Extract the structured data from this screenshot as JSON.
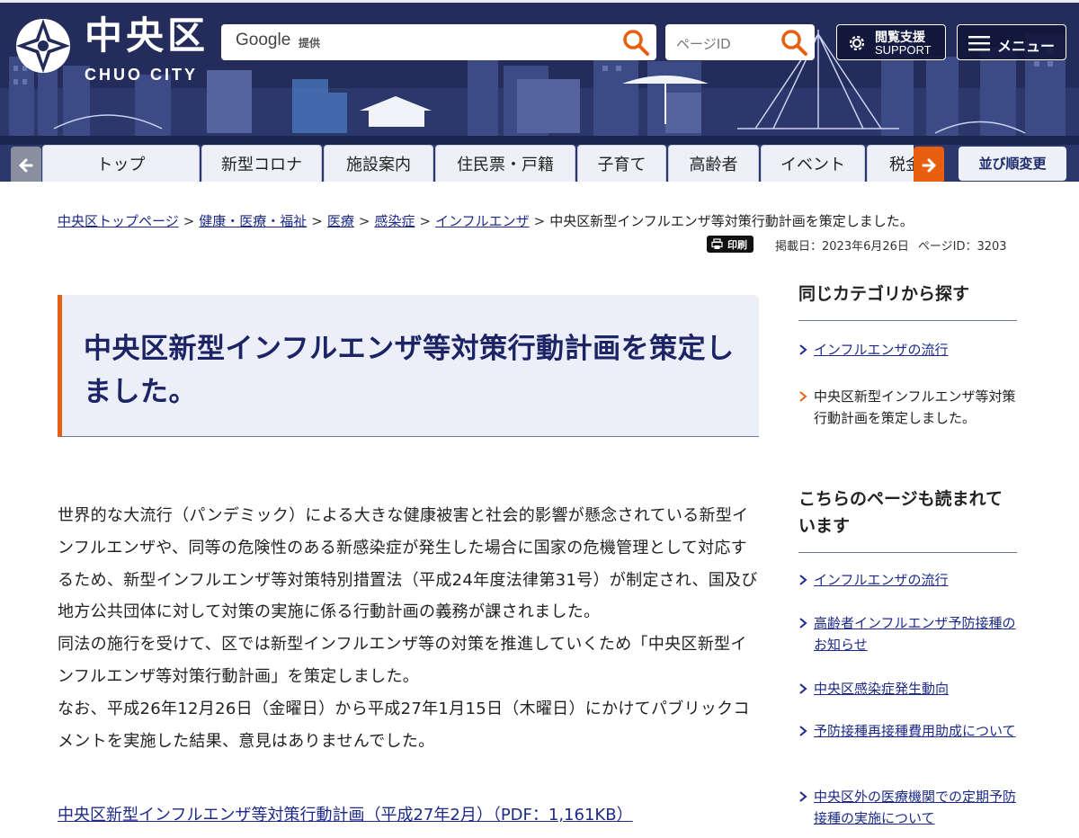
{
  "header": {
    "logo_kanji": "中央区",
    "logo_roman": "CHUO CITY",
    "google_label": "Google",
    "google_sub": "提供",
    "pageid_placeholder": "ページID",
    "support_line1": "閲覧支援",
    "support_line2": "SUPPORT",
    "menu_label": "メニュー",
    "colors": {
      "background": "#232c5a",
      "accent": "#e8600f",
      "title_text": "#1c2466"
    }
  },
  "nav": {
    "tabs": [
      "トップ",
      "新型コロナ",
      "施設案内",
      "住民票・戸籍",
      "子育て",
      "高齢者",
      "イベント",
      "税金"
    ],
    "sort_label": "並び順変更"
  },
  "breadcrumb": {
    "items": [
      "中央区トップページ",
      "健康・医療・福祉",
      "医療",
      "感染症",
      "インフルエンザ"
    ],
    "separator": ">",
    "current": "中央区新型インフルエンザ等対策行動計画を策定しました。"
  },
  "meta": {
    "print_label": "印刷",
    "published": "掲載日：2023年6月26日",
    "page_id": "ページID：3203"
  },
  "article": {
    "title": "中央区新型インフルエンザ等対策行動計画を策定しました。",
    "paragraphs": [
      "世界的な大流行（パンデミック）による大きな健康被害と社会的影響が懸念されている新型インフルエンザや、同等の危険性のある新感染症が発生した場合に国家の危機管理として対応するため、新型インフルエンザ等対策特別措置法（平成24年度法律第31号）が制定され、国及び地方公共団体に対して対策の実施に係る行動計画の義務が課されました。",
      "同法の施行を受けて、区では新型インフルエンザ等の対策を推進していくため「中央区新型インフルエンザ等対策行動計画」を策定しました。",
      "なお、平成26年12月26日（金曜日）から平成27年1月15日（木曜日）にかけてパブリックコメントを実施した結果、意見はありませんでした。"
    ],
    "pdf_link": "中央区新型インフルエンザ等対策行動計画（平成27年2月）（PDF：1,161KB）"
  },
  "sidebar": {
    "same_category": {
      "heading": "同じカテゴリから探す",
      "items": [
        {
          "label": "インフルエンザの流行",
          "current": false
        },
        {
          "label": "中央区新型インフルエンザ等対策行動計画を策定しました。",
          "current": true
        }
      ]
    },
    "also_read": {
      "heading": "こちらのページも読まれています",
      "items": [
        "インフルエンザの流行",
        "高齢者インフルエンザ予防接種のお知らせ",
        "中央区感染症発生動向",
        "予防接種再接種費用助成について",
        "中央区外の医療機関での定期予防接種の実施について"
      ]
    }
  }
}
